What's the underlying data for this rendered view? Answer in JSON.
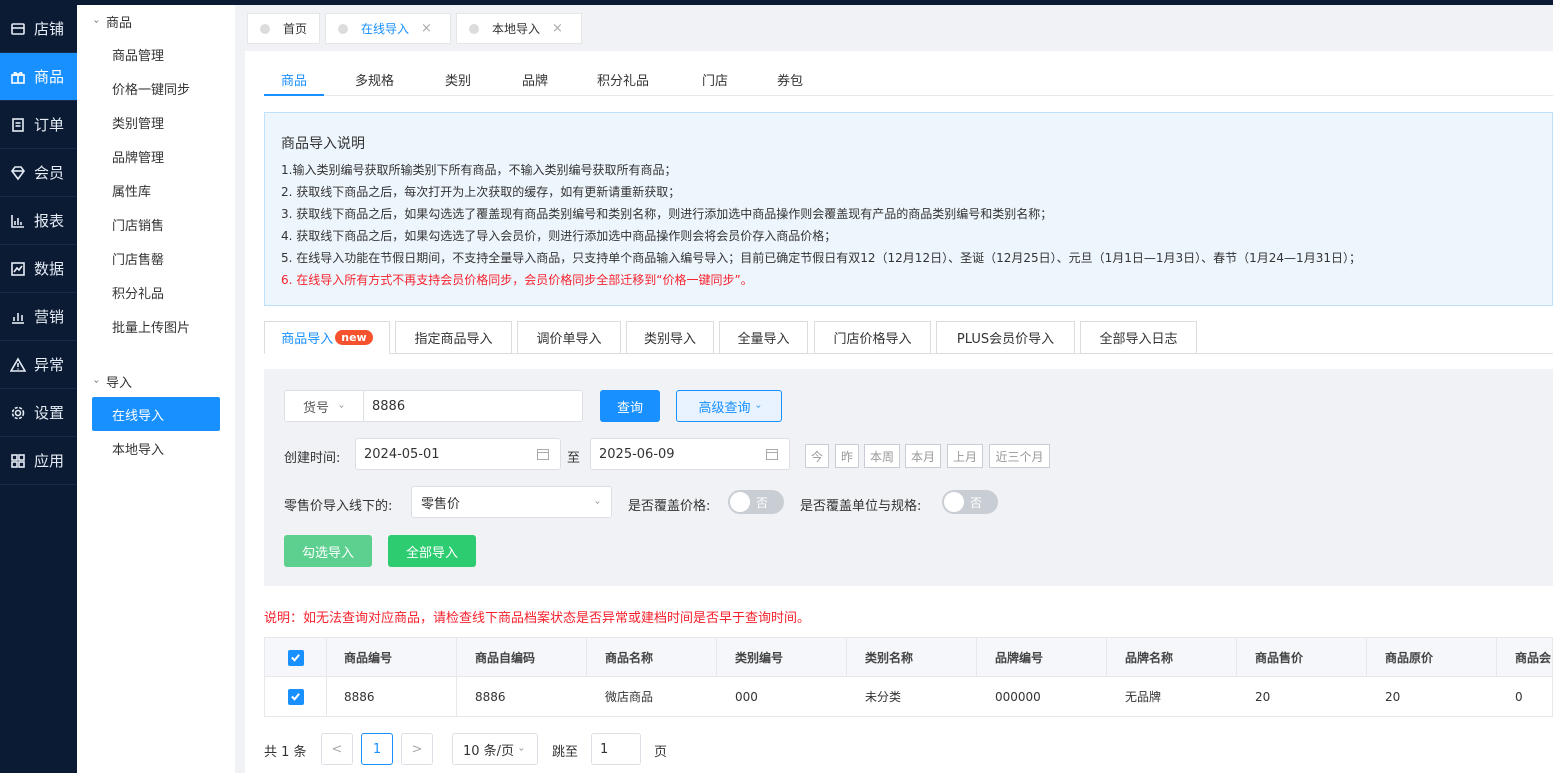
{
  "rail": {
    "items": [
      {
        "label": "店铺",
        "icon": "store-icon"
      },
      {
        "label": "商品",
        "icon": "gift-icon"
      },
      {
        "label": "订单",
        "icon": "order-icon"
      },
      {
        "label": "会员",
        "icon": "diamond-icon"
      },
      {
        "label": "报表",
        "icon": "chart-icon"
      },
      {
        "label": "数据",
        "icon": "data-icon"
      },
      {
        "label": "营销",
        "icon": "bar-chart-icon"
      },
      {
        "label": "异常",
        "icon": "warning-icon"
      },
      {
        "label": "设置",
        "icon": "gear-icon"
      },
      {
        "label": "应用",
        "icon": "apps-icon"
      }
    ]
  },
  "subnav": {
    "group1": "商品",
    "items1": [
      "商品管理",
      "价格一键同步",
      "类别管理",
      "品牌管理",
      "属性库",
      "门店销售",
      "门店售罄",
      "积分礼品",
      "批量上传图片"
    ],
    "group2": "导入",
    "items2": [
      "在线导入",
      "本地导入"
    ]
  },
  "page_tabs": [
    {
      "label": "首页"
    },
    {
      "label": "在线导入",
      "close": "×"
    },
    {
      "label": "本地导入",
      "close": "×"
    }
  ],
  "category_tabs": [
    "商品",
    "多规格",
    "类别",
    "品牌",
    "积分礼品",
    "门店",
    "券包"
  ],
  "info": {
    "title": "商品导入说明",
    "lines": [
      "1.输入类别编号获取所输类别下所有商品，不输入类别编号获取所有商品；",
      "2. 获取线下商品之后，每次打开为上次获取的缓存，如有更新请重新获取；",
      "3. 获取线下商品之后，如果勾选选了覆盖现有商品类别编号和类别名称，则进行添加选中商品操作则会覆盖现有产品的商品类别编号和类别名称；",
      "4. 获取线下商品之后，如果勾选选了导入会员价，则进行添加选中商品操作则会将会员价存入商品价格；",
      "5. 在线导入功能在节假日期间，不支持全量导入商品，只支持单个商品输入编号导入；目前已确定节假日有双12（12月12日）、圣诞（12月25日）、元旦（1月1日—1月3日）、春节（1月24—1月31日）；",
      "6. 在线导入所有方式不再支持会员价格同步，会员价格同步全部迁移到“价格一键同步”。"
    ]
  },
  "import_tabs": {
    "first": "商品导入",
    "badge": "new",
    "rest": [
      "指定商品导入",
      "调价单导入",
      "类别导入",
      "全量导入",
      "门店价格导入",
      "PLUS会员价导入",
      "全部导入日志"
    ]
  },
  "filter": {
    "field_select": "货号",
    "search_value": "8886",
    "query_btn": "查询",
    "adv_btn": "高级查询",
    "created_label": "创建时间:",
    "date_from": "2024-05-01",
    "to_label": "至",
    "date_to": "2025-06-09",
    "quick": [
      "今",
      "昨",
      "本周",
      "本月",
      "上月",
      "近三个月"
    ],
    "retail_label": "零售价导入线下的:",
    "retail_value": "零售价",
    "cover_price_label": "是否覆盖价格:",
    "cover_price_value": "否",
    "cover_unit_label": "是否覆盖单位与规格:",
    "cover_unit_value": "否",
    "btn_checked_import": "勾选导入",
    "btn_all_import": "全部导入"
  },
  "note": "说明：如无法查询对应商品，请检查线下商品档案状态是否异常或建档时间是否早于查询时间。",
  "table": {
    "headers": [
      "商品编号",
      "商品自编码",
      "商品名称",
      "类别编号",
      "类别名称",
      "品牌编号",
      "品牌名称",
      "商品售价",
      "商品原价",
      "商品会"
    ],
    "rows": [
      [
        "8886",
        "8886",
        "微店商品",
        "000",
        "未分类",
        "000000",
        "无品牌",
        "20",
        "20",
        "0"
      ]
    ]
  },
  "pager": {
    "total": "共 1 条",
    "prev": "<",
    "page": "1",
    "next": ">",
    "size": "10 条/页",
    "jump_label": "跳至",
    "jump_value": "1",
    "page_suffix": "页"
  },
  "colors": {
    "accent": "#1890ff",
    "rail_bg": "#0b1b33",
    "green": "#2ecc71",
    "red": "#f5222d"
  }
}
